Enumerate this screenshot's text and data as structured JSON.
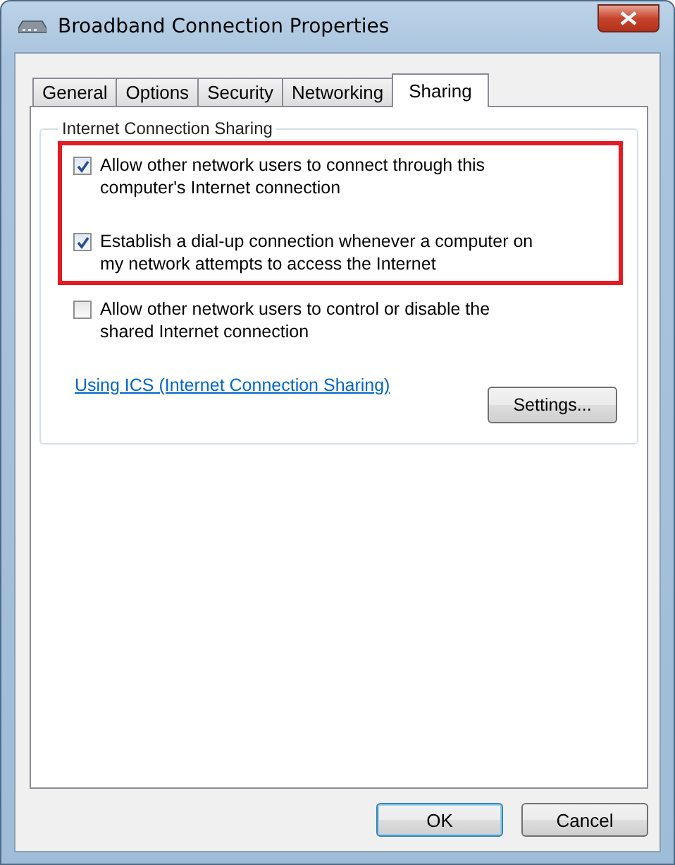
{
  "window": {
    "title": "Broadband Connection Properties"
  },
  "tabs": [
    {
      "label": "General",
      "selected": false
    },
    {
      "label": "Options",
      "selected": false
    },
    {
      "label": "Security",
      "selected": false
    },
    {
      "label": "Networking",
      "selected": false
    },
    {
      "label": "Sharing",
      "selected": true
    }
  ],
  "group": {
    "title": "Internet Connection Sharing",
    "option_groups": [
      {
        "highlighted": true,
        "options": [
          {
            "label": "Allow other network users to connect through this computer's Internet connection",
            "checked": true
          },
          {
            "label": "Establish a dial-up connection whenever a computer on my network attempts to access the Internet",
            "checked": true
          }
        ]
      },
      {
        "highlighted": false,
        "options": [
          {
            "label": "Allow other network users to control or disable the shared Internet connection",
            "checked": false
          }
        ]
      }
    ],
    "link": "Using ICS (Internet Connection Sharing)",
    "settings_button": "Settings..."
  },
  "buttons": [
    {
      "label": "OK",
      "default": true
    },
    {
      "label": "Cancel",
      "default": false
    }
  ]
}
